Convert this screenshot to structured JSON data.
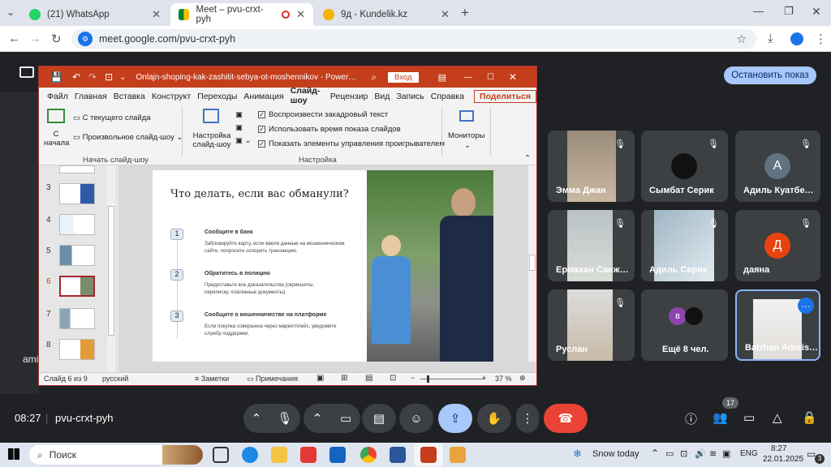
{
  "browser": {
    "tabs": [
      {
        "title": "(21) WhatsApp"
      },
      {
        "title": "Meet – pvu-crxt-pyh"
      },
      {
        "title": "9д - Kundelik.kz"
      }
    ],
    "url": "meet.google.com/pvu-crxt-pyh"
  },
  "meet": {
    "stop_presenting": "Остановить показ",
    "participants": [
      {
        "name": "Эмма Джан"
      },
      {
        "name": "Сымбат Серик"
      },
      {
        "name": "Адиль Куатбе…",
        "initial": "А"
      },
      {
        "name": "Ермахан Санж…"
      },
      {
        "name": "Адиль Серик"
      },
      {
        "name": "даяна",
        "initial": "Д"
      },
      {
        "name": "Руслан"
      },
      {
        "name": "Ещё 8 чел.",
        "initial": "в"
      },
      {
        "name": "Balzhan Adreis…"
      }
    ],
    "time": "08:27",
    "meeting_code": "pvu-crxt-pyh",
    "people_count": "17",
    "left_edge_label": "ami"
  },
  "ppt": {
    "title": "Onlajn-shoping-kak-zashitit-sebya-ot-moshennikov - Power…",
    "signin": "Вход",
    "menu": [
      "Файл",
      "Главная",
      "Вставка",
      "Конструкт",
      "Переходы",
      "Анимация",
      "Слайд-шоу",
      "Рецензир",
      "Вид",
      "Запись",
      "Справка"
    ],
    "share": "Поделиться",
    "ribbon": {
      "from_start": "С начала",
      "from_current": "С текущего слайда",
      "custom": "Произвольное слайд-шоу",
      "group1": "Начать слайд-шоу",
      "setup": "Настройка слайд-шоу",
      "opt1": "Воспроизвести закадровый текст",
      "opt2": "Использовать время показа слайдов",
      "opt3": "Показать элементы управления проигрывателем",
      "group2": "Настройка",
      "monitors": "Мониторы"
    },
    "thumbs": [
      "3",
      "4",
      "5",
      "6",
      "7",
      "8"
    ],
    "slide": {
      "title": "Что делать, если вас обманули?",
      "steps": [
        {
          "num": "1",
          "head": "Сообщите в банк",
          "body": "Заблокируйте карту, если ввели данные на мошенническом сайте, попросите оспорить транзакцию."
        },
        {
          "num": "2",
          "head": "Обратитесь в полицию",
          "body": "Предоставьте все доказательства (скриншоты, переписку, платежные документы)."
        },
        {
          "num": "3",
          "head": "Сообщите о мошенничестве на платформе",
          "body": "Если покупка совершена через маркетплейс, уведомите службу поддержки."
        }
      ]
    },
    "status": {
      "slide": "Слайд 6 из 9",
      "lang": "русский",
      "notes": "Заметки",
      "comments": "Примечания",
      "zoom": "37 %"
    }
  },
  "taskbar": {
    "search": "Поиск",
    "weather": "Snow today",
    "lang": "ENG",
    "time": "8:27",
    "date": "22.01.2025",
    "badge": "3"
  }
}
